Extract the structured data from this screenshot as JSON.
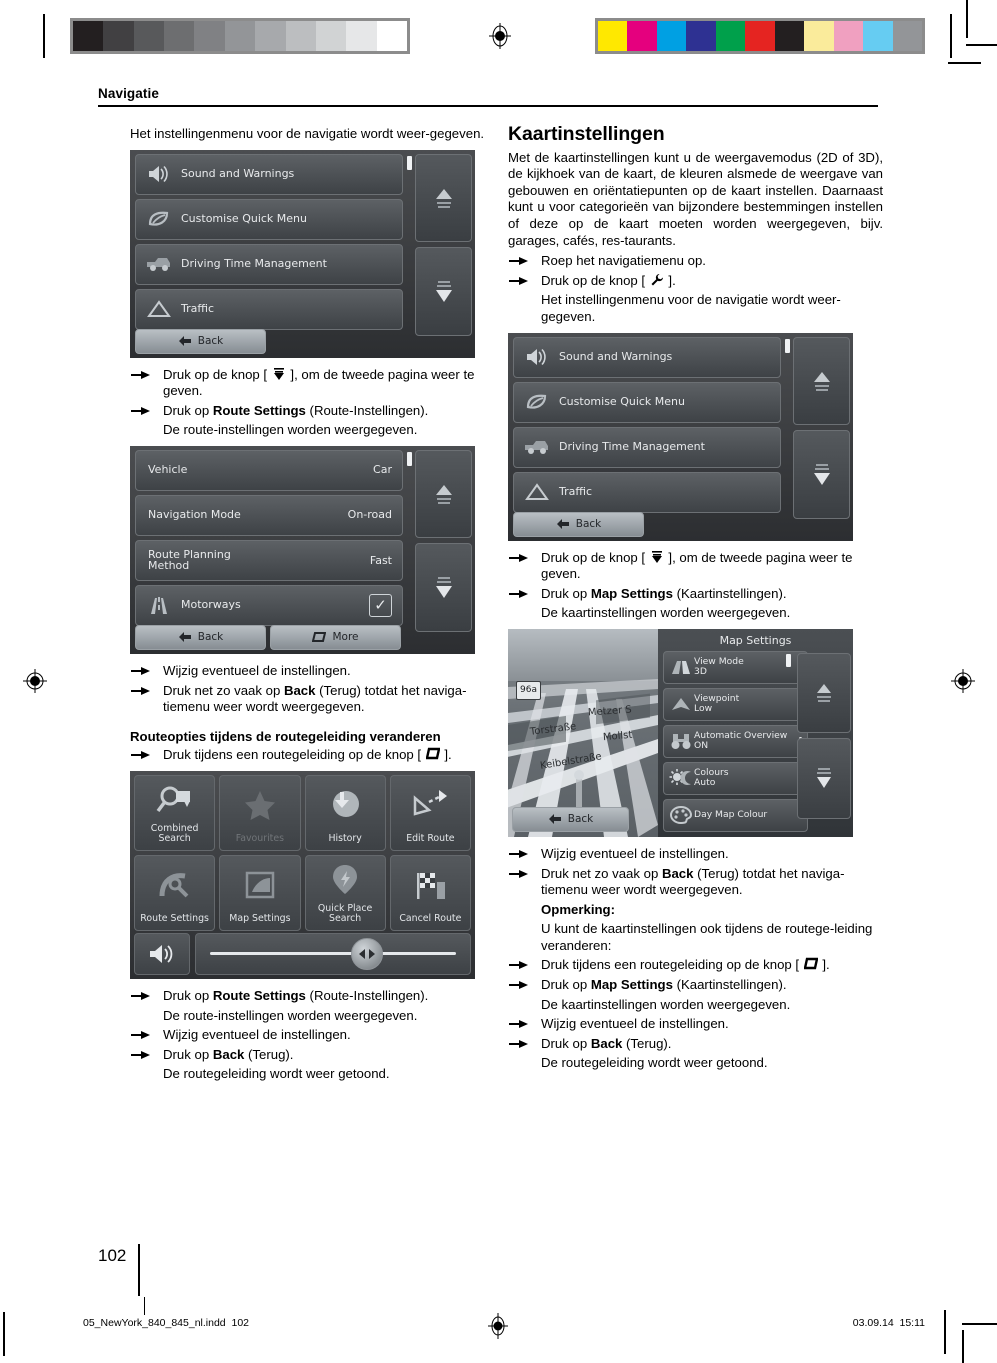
{
  "print_marks": {
    "grayscale_patches": [
      "#231f20",
      "#414042",
      "#58595b",
      "#6d6e70",
      "#808184",
      "#939598",
      "#a7a9ac",
      "#bcbec0",
      "#d1d3d4",
      "#e6e7e8",
      "#ffffff"
    ],
    "color_patches": [
      "#ffe800",
      "#e5007e",
      "#00a0e3",
      "#2e3192",
      "#00a04b",
      "#e52421",
      "#231f20",
      "#faeb9b",
      "#f0a0c0",
      "#66ccf2",
      "#939598"
    ]
  },
  "header": {
    "running_head": "Navigatie"
  },
  "left_column": {
    "intro": "Het instellingenmenu voor de navigatie wordt weer-gegeven.",
    "settings_screen": {
      "rows": [
        {
          "icon": "speaker-icon",
          "label": "Sound and Warnings",
          "value": ""
        },
        {
          "icon": "leaf-icon",
          "label": "Customise Quick Menu",
          "value": ""
        },
        {
          "icon": "truck-icon",
          "label": "Driving Time Management",
          "value": ""
        },
        {
          "icon": "warning-triangle-icon",
          "label": "Traffic",
          "value": ""
        }
      ],
      "back_label": "Back"
    },
    "steps_1": [
      {
        "parts": [
          {
            "t": "Druk op de knop [ ",
            "b": false
          },
          {
            "t": "KEY_PAGE_DOWN",
            "b": false,
            "icon": true
          },
          {
            "t": " ], om de tweede pagina weer te geven.",
            "b": false
          }
        ]
      },
      {
        "parts": [
          {
            "t": "Druk op ",
            "b": false
          },
          {
            "t": "Route Settings",
            "b": true
          },
          {
            "t": " (Route-Instellingen).",
            "b": false
          }
        ]
      }
    ],
    "note_1": "De route-instellingen worden weergegeven.",
    "route_screen": {
      "rows": [
        {
          "icon": "",
          "label": "Vehicle",
          "value": "Car"
        },
        {
          "icon": "",
          "label": "Navigation Mode",
          "value": "On-road"
        },
        {
          "icon": "",
          "label": "Route Planning\nMethod",
          "value": "Fast"
        },
        {
          "icon": "motorway-icon",
          "label": "Motorways",
          "value": "checkbox"
        }
      ],
      "back_label": "Back",
      "more_label": "More"
    },
    "steps_2": [
      {
        "parts": [
          {
            "t": "Wijzig eventueel de instellingen.",
            "b": false
          }
        ]
      },
      {
        "parts": [
          {
            "t": "Druk net zo vaak op ",
            "b": false
          },
          {
            "t": "Back",
            "b": true
          },
          {
            "t": " (Terug) totdat het naviga-tiemenu weer wordt weergegeven.",
            "b": false
          }
        ]
      }
    ],
    "subheading": "Routeopties tijdens de routegeleiding veranderen",
    "steps_3": [
      {
        "parts": [
          {
            "t": "Druk tijdens een routegeleiding op de knop [ ",
            "b": false
          },
          {
            "t": "KEY_MENU",
            "b": false,
            "icon": true
          },
          {
            "t": " ].",
            "b": false
          }
        ]
      }
    ],
    "quick_menu_screen": {
      "tiles": [
        {
          "icon": "combined-search-icon",
          "label": "Combined\nSearch",
          "dim": false
        },
        {
          "icon": "star-icon",
          "label": "Favourites",
          "dim": true
        },
        {
          "icon": "history-icon",
          "label": "History",
          "dim": false
        },
        {
          "icon": "edit-route-icon",
          "label": "Edit Route",
          "dim": false
        },
        {
          "icon": "route-settings-icon",
          "label": "Route Settings",
          "dim": false
        },
        {
          "icon": "map-settings-icon",
          "label": "Map Settings",
          "dim": false
        },
        {
          "icon": "quick-place-search-icon",
          "label": "Quick Place\nSearch",
          "dim": false
        },
        {
          "icon": "checkered-flag-icon",
          "label": "Cancel Route",
          "dim": false
        }
      ],
      "volume_icon": "speaker-icon"
    },
    "steps_4": [
      {
        "parts": [
          {
            "t": "Druk op ",
            "b": false
          },
          {
            "t": "Route Settings",
            "b": true
          },
          {
            "t": " (Route-Instellingen).",
            "b": false
          }
        ]
      }
    ],
    "note_2": "De route-instellingen worden weergegeven.",
    "steps_5": [
      {
        "parts": [
          {
            "t": "Wijzig eventueel de instellingen.",
            "b": false
          }
        ]
      },
      {
        "parts": [
          {
            "t": "Druk op ",
            "b": false
          },
          {
            "t": "Back",
            "b": true
          },
          {
            "t": " (Terug).",
            "b": false
          }
        ]
      }
    ],
    "note_3": "De routegeleiding wordt weer getoond."
  },
  "right_column": {
    "section_title": "Kaartinstellingen",
    "intro": "Met de kaartinstellingen kunt u de weergavemodus (2D of 3D), de kijkhoek van de kaart, de kleuren alsmede de weergave van gebouwen en oriëntatiepunten op de kaart instellen. Daarnaast kunt u voor categorieën van bijzondere bestemmingen instellen of deze op de kaart moeten worden weergegeven, bijv. garages, cafés, res-taurants.",
    "steps_1": [
      {
        "parts": [
          {
            "t": "Roep het navigatiemenu op.",
            "b": false
          }
        ]
      },
      {
        "parts": [
          {
            "t": "Druk op de knop [ ",
            "b": false
          },
          {
            "t": "KEY_WRENCH",
            "b": false,
            "icon": true
          },
          {
            "t": " ].",
            "b": false
          }
        ]
      }
    ],
    "note_1": "Het instellingenmenu voor de navigatie wordt weer-gegeven.",
    "settings_screen": {
      "rows": [
        {
          "icon": "speaker-icon",
          "label": "Sound and Warnings",
          "value": ""
        },
        {
          "icon": "leaf-icon",
          "label": "Customise Quick Menu",
          "value": ""
        },
        {
          "icon": "truck-icon",
          "label": "Driving Time Management",
          "value": ""
        },
        {
          "icon": "warning-triangle-icon",
          "label": "Traffic",
          "value": ""
        }
      ],
      "back_label": "Back"
    },
    "steps_2": [
      {
        "parts": [
          {
            "t": "Druk op de knop [ ",
            "b": false
          },
          {
            "t": "KEY_PAGE_DOWN",
            "b": false,
            "icon": true
          },
          {
            "t": " ], om de tweede pagina weer te geven.",
            "b": false
          }
        ]
      },
      {
        "parts": [
          {
            "t": "Druk op ",
            "b": false
          },
          {
            "t": "Map Settings",
            "b": true
          },
          {
            "t": " (Kaartinstellingen).",
            "b": false
          }
        ]
      }
    ],
    "note_2": "De kaartinstellingen worden weergegeven.",
    "map_screen": {
      "panel_title": "Map Settings",
      "street_labels": [
        "Metzer S",
        "Torstraße",
        "Mollst",
        "Keibelstraße"
      ],
      "route_shield": "96a",
      "rows": [
        {
          "icon": "view-mode-icon",
          "label": "View Mode\n3D",
          "dots": 2
        },
        {
          "icon": "viewpoint-icon",
          "label": "Viewpoint\nLow",
          "dots": 3
        },
        {
          "icon": "binoculars-icon",
          "label": "Automatic Overview\nON",
          "dots": 2
        },
        {
          "icon": "sun-moon-icon",
          "label": "Colours\nAuto",
          "dots": 3
        },
        {
          "icon": "palette-icon",
          "label": "Day Map Colour",
          "dots": 0
        }
      ],
      "back_label": "Back"
    },
    "steps_3": [
      {
        "parts": [
          {
            "t": "Wijzig eventueel de instellingen.",
            "b": false
          }
        ]
      },
      {
        "parts": [
          {
            "t": "Druk net zo vaak op ",
            "b": false
          },
          {
            "t": "Back",
            "b": true
          },
          {
            "t": " (Terug) totdat het naviga-tiemenu weer wordt weergegeven.",
            "b": false
          }
        ]
      }
    ],
    "note_label": "Opmerking:",
    "note_3": "U kunt de kaartinstellingen ook tijdens de routege-leiding veranderen:",
    "steps_4": [
      {
        "parts": [
          {
            "t": "Druk tijdens een routegeleiding op de knop [ ",
            "b": false
          },
          {
            "t": "KEY_MENU",
            "b": false,
            "icon": true
          },
          {
            "t": " ].",
            "b": false
          }
        ]
      },
      {
        "parts": [
          {
            "t": "Druk op ",
            "b": false
          },
          {
            "t": "Map Settings",
            "b": true
          },
          {
            "t": " (Kaartinstellingen).",
            "b": false
          }
        ]
      }
    ],
    "note_4": "De kaartinstellingen worden weergegeven.",
    "steps_5": [
      {
        "parts": [
          {
            "t": "Wijzig eventueel de instellingen.",
            "b": false
          }
        ]
      },
      {
        "parts": [
          {
            "t": "Druk op ",
            "b": false
          },
          {
            "t": "Back",
            "b": true
          },
          {
            "t": " (Terug).",
            "b": false
          }
        ]
      }
    ],
    "note_5": "De routegeleiding wordt weer getoond."
  },
  "footer": {
    "page_number": "102",
    "file_name": "05_NewYork_840_845_nl.indd",
    "file_page": "102",
    "date": "03.09.14",
    "time": "15:11"
  }
}
